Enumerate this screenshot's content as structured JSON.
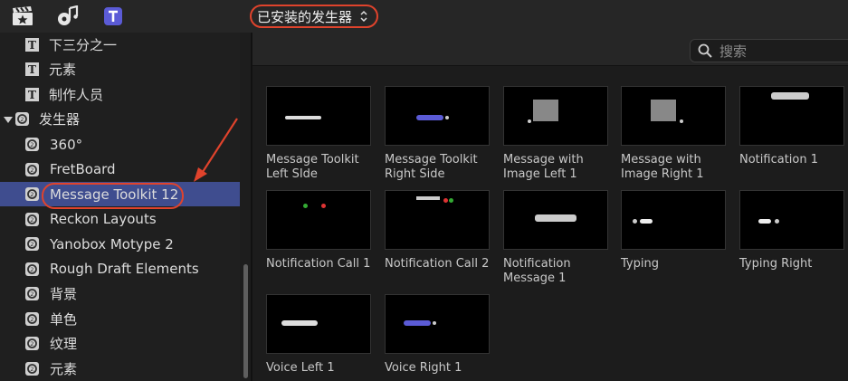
{
  "toolbar": {
    "icons": [
      "clapper-star-icon",
      "music-camera-icon",
      "titles-icon"
    ],
    "source_popup": "已安装的发生器"
  },
  "sidebar": {
    "title_items": [
      "下三分之一",
      "元素",
      "制作人员"
    ],
    "category": "发生器",
    "generator_items": [
      "360°",
      "FretBoard",
      "Message Toolkit 12",
      "Reckon Layouts",
      "Yanobox Motype 2",
      "Rough Draft Elements",
      "背景",
      "单色",
      "纹理",
      "元素"
    ],
    "selected": "Message Toolkit 12"
  },
  "search": {
    "placeholder": "搜索"
  },
  "tiles": [
    {
      "label": "Message Toolkit\nLeft SIde"
    },
    {
      "label": "Message Toolkit\nRight Side"
    },
    {
      "label": "Message with\nImage Left 1"
    },
    {
      "label": "Message with\nImage Right 1"
    },
    {
      "label": "Notification 1"
    },
    {
      "label": "Notification Call 1"
    },
    {
      "label": "Notification Call 2"
    },
    {
      "label": "Notification\nMessage 1"
    },
    {
      "label": "Typing"
    },
    {
      "label": "Typing Right"
    },
    {
      "label": "Voice Left 1"
    },
    {
      "label": "Voice Right 1"
    }
  ],
  "colors": {
    "accent": "#3f4d8f",
    "annotation": "#e0432c",
    "tile_accent": "#5b5bd6"
  }
}
